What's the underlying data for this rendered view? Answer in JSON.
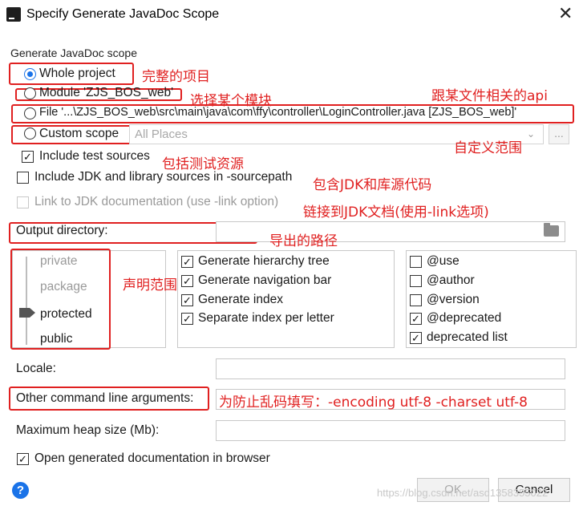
{
  "window": {
    "title": "Specify Generate JavaDoc Scope",
    "app_icon_text": "IJ",
    "close_glyph": "✕"
  },
  "scope": {
    "group_title": "Generate JavaDoc scope",
    "whole_project": "Whole project",
    "module": "Module 'ZJS_BOS_web'",
    "file": "File '...\\ZJS_BOS_web\\src\\main\\java\\com\\ffy\\controller\\LoginController.java [ZJS_BOS_web]'",
    "custom_scope": "Custom scope",
    "custom_scope_value": "All Places",
    "combo_arrow": "⌄",
    "ellipsis": "...",
    "selected": "whole_project"
  },
  "options": {
    "include_test_sources": "Include test sources",
    "include_test_sources_checked": true,
    "include_jdk": "Include JDK and library sources in -sourcepath",
    "include_jdk_checked": false,
    "link_jdk": "Link to JDK documentation (use -link option)",
    "link_jdk_checked": false
  },
  "output": {
    "label": "Output directory:",
    "value": ""
  },
  "visibility": {
    "levels": [
      "private",
      "package",
      "protected",
      "public"
    ],
    "selected": "protected"
  },
  "generate": {
    "items": [
      {
        "label": "Generate hierarchy tree",
        "checked": true
      },
      {
        "label": "Generate navigation bar",
        "checked": true
      },
      {
        "label": "Generate index",
        "checked": true
      },
      {
        "label": "Separate index per letter",
        "checked": true
      }
    ]
  },
  "tags": {
    "items": [
      {
        "label": "@use",
        "checked": false
      },
      {
        "label": "@author",
        "checked": false
      },
      {
        "label": "@version",
        "checked": false
      },
      {
        "label": "@deprecated",
        "checked": true
      },
      {
        "label": "deprecated list",
        "checked": true
      }
    ]
  },
  "locale": {
    "label": "Locale:",
    "value": ""
  },
  "other_args": {
    "label": "Other command line arguments:",
    "value": ""
  },
  "heap": {
    "label": "Maximum heap size (Mb):",
    "value": ""
  },
  "open_browser": {
    "label": "Open generated documentation in browser",
    "checked": true
  },
  "footer": {
    "help": "?",
    "ok": "OK",
    "cancel": "Cancel",
    "watermark": "https://blog.csdn.net/asd1358355022"
  },
  "annotations": {
    "whole_project": "完整的项目",
    "module": "选择某个模块",
    "file": "跟某文件相关的api",
    "custom_scope": "自定义范围",
    "test_sources": "包括测试资源",
    "jdk": "包含JDK和库源代码",
    "link": "链接到JDK文档(使用-link选项)",
    "output": "导出的路径",
    "visibility": "声明范围",
    "other_args": "为防止乱码填写：-encoding utf-8 -charset utf-8"
  },
  "colors": {
    "accent": "#1a73e8",
    "annotation_red": "#e02020",
    "border": "#c8c8c8"
  }
}
